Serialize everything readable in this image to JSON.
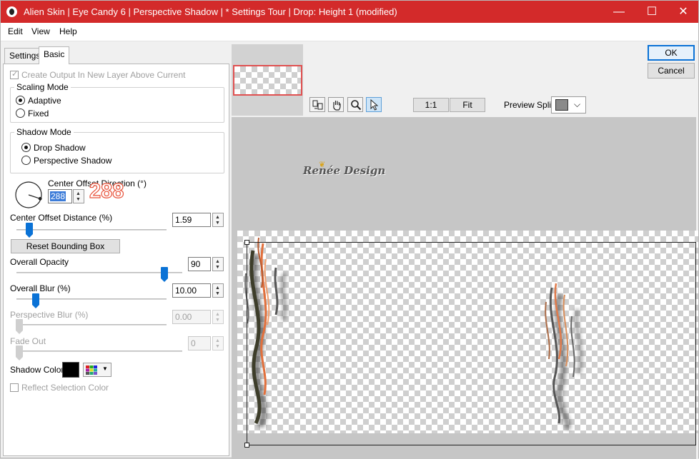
{
  "window": {
    "title": "Alien Skin | Eye Candy 6 | Perspective Shadow | * Settings Tour | Drop: Height 1 (modified)",
    "minimize": "—",
    "maximize": "☐",
    "close": "✕"
  },
  "menu": {
    "edit": "Edit",
    "view": "View",
    "help": "Help"
  },
  "tabs": {
    "settings": "Settings",
    "basic": "Basic"
  },
  "options": {
    "create_output": "Create Output In New Layer Above Current",
    "scaling_mode": {
      "label": "Scaling Mode",
      "adaptive": "Adaptive",
      "fixed": "Fixed",
      "selected": "Adaptive"
    },
    "shadow_mode": {
      "label": "Shadow Mode",
      "drop": "Drop Shadow",
      "perspective": "Perspective Shadow",
      "selected": "Drop Shadow"
    },
    "direction": {
      "label": "Center Offset Direction (°)",
      "value": "288",
      "annotation": "288"
    },
    "distance": {
      "label": "Center Offset Distance (%)",
      "value": "1.59",
      "slider": 0.08
    },
    "reset_button": "Reset Bounding Box",
    "opacity": {
      "label": "Overall Opacity",
      "value": "90",
      "slider": 0.9
    },
    "blur": {
      "label": "Overall Blur (%)",
      "value": "10.00",
      "slider": 0.12
    },
    "perspective_blur": {
      "label": "Perspective Blur (%)",
      "value": "0.00",
      "slider": 0
    },
    "fade_out": {
      "label": "Fade Out",
      "value": "0",
      "slider": 0
    },
    "shadow_color": {
      "label": "Shadow Color",
      "color": "#000000"
    },
    "reflect": "Reflect Selection Color"
  },
  "toolbar": {
    "ok": "OK",
    "cancel": "Cancel",
    "zoom_1to1": "1:1",
    "fit": "Fit",
    "preview_split_label": "Preview Split:"
  },
  "watermark": "Renée Design",
  "colors": {
    "title_bar": "#d32a2a",
    "accent": "#0a72d6",
    "annotation": "#e8523a"
  }
}
